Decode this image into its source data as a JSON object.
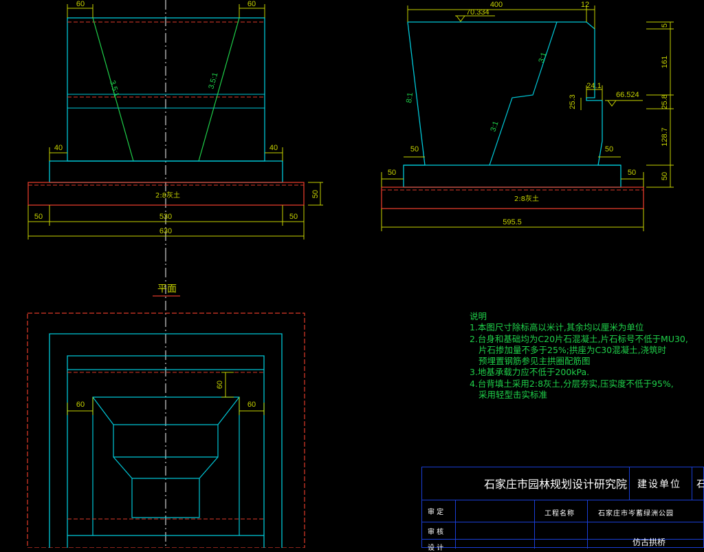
{
  "section_views": {
    "left_dims": {
      "top_left": "60",
      "top_right": "60",
      "mid_left": "40",
      "mid_right": "40",
      "bottom_left": "50",
      "bottom_right": "50",
      "middle": "530",
      "overall": "630",
      "height": "50"
    },
    "left_slopes": {
      "left": "3.5:1",
      "right": "3.5:1"
    },
    "fill_left": "2:8灰土",
    "right_dims": {
      "top": "400",
      "top_right": "12",
      "elevation_top": "70.334",
      "elevation_seat": "66.524",
      "right_height_1": "5",
      "right_height_2": "161",
      "right_height_3": "25.8",
      "right_height_4": "128.7",
      "right_height_5": "50",
      "seat_width": "24.1",
      "seat_height": "25.3",
      "base_left": "50",
      "base_right": "50",
      "foot_left": "50",
      "foot_right": "50",
      "overall": "595.5"
    },
    "right_slopes": {
      "back": "8:1",
      "upper": "3:1",
      "lower": "3:1"
    },
    "fill_right": "2:8灰土"
  },
  "plan_view": {
    "label": "平面",
    "dims": {
      "offset": "60",
      "left": "60",
      "right": "60"
    }
  },
  "notes": {
    "heading": "说明",
    "lines": [
      "1.本图尺寸除标高以米计,其余均以厘米为单位",
      "2.台身和基础均为C20片石混凝土,片石标号不低于MU30,",
      "片石掺加量不多于25%;拱座为C30混凝土,浇筑时",
      "预埋置钢筋参见主拱圈配筋图",
      "3.地基承载力应不低于200kPa.",
      "4.台背填土采用2:8灰土,分层夯实,压实度不低于95%,",
      "采用轻型击实标准"
    ]
  },
  "title_block": {
    "institute": "石家庄市园林规划设计研究院",
    "client_label": "建设单位",
    "client_value_partial": "石",
    "rows": [
      "审  定",
      "审  核",
      "设  计"
    ],
    "project_label": "工程名称",
    "project_value": "石家庄市岑蓄绿洲公园",
    "drawing_title": "仿古拱桥"
  },
  "colors": {
    "cyan": "#00c8d8",
    "yellow": "#c8d400",
    "green": "#1fd14a",
    "red_dash": "#e03a2a",
    "blue": "#1a3fd8",
    "white": "#ffffff"
  }
}
